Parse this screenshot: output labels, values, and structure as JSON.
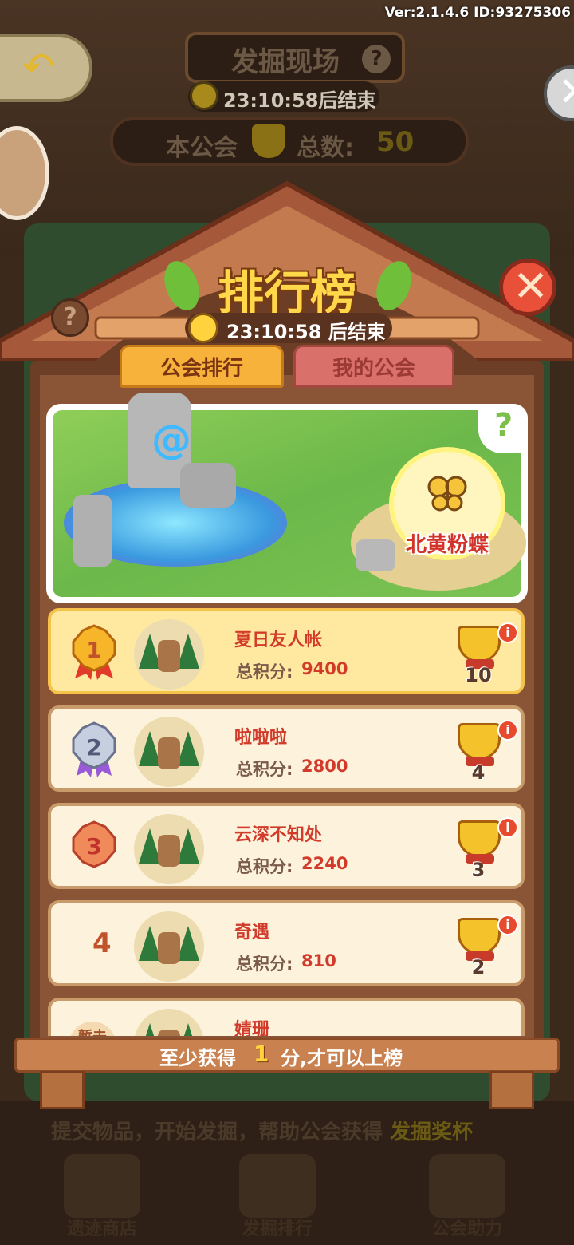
{
  "app": {
    "version_label": "Ver:2.1.4.6 ID:93275306"
  },
  "background": {
    "dig_site_title": "发掘现场",
    "timer_text": "23:10:58后结束",
    "guild_total_label_1": "本公会",
    "guild_total_label_2": "总数:",
    "guild_total_value": "50",
    "hint_text": "提交物品，开始发掘，帮助公会获得",
    "hint_highlight": "发掘奖杯",
    "nav": [
      {
        "label": "遗迹商店",
        "icon": "shop-icon"
      },
      {
        "label": "发掘排行",
        "icon": "trophy-icon"
      },
      {
        "label": "公会助力",
        "icon": "guild-help-icon"
      }
    ]
  },
  "modal": {
    "title": "排行榜",
    "timer_text": "23:10:58 后结束",
    "tabs": [
      {
        "label": "公会排行",
        "active": true
      },
      {
        "label": "我的公会",
        "active": false
      }
    ],
    "banner": {
      "butterfly_name": "北黄粉蝶",
      "help_mark": "?"
    },
    "help_mark": "?",
    "score_label": "总积分:",
    "rows": [
      {
        "rank": "1",
        "name": "夏日友人帐",
        "score": "9400",
        "trophies": "10",
        "medal": "gold"
      },
      {
        "rank": "2",
        "name": "啦啦啦",
        "score": "2800",
        "trophies": "4",
        "medal": "silver"
      },
      {
        "rank": "3",
        "name": "云深不知处",
        "score": "2240",
        "trophies": "3",
        "medal": "bronze"
      },
      {
        "rank": "4",
        "name": "奇遇",
        "score": "810",
        "trophies": "2",
        "medal": "none"
      },
      {
        "rank": "暂未",
        "name": "婧珊",
        "score": "",
        "trophies": "",
        "medal": "none"
      }
    ],
    "footer": {
      "text_before": "至少获得",
      "min_points": "1",
      "text_after": "分,才可以上榜"
    }
  },
  "colors": {
    "title": "#ffd84a",
    "active_tab": "#f7b23c",
    "inactive_tab": "#d9716a",
    "name_red": "#d23a2a",
    "wood": "#8a5536"
  }
}
